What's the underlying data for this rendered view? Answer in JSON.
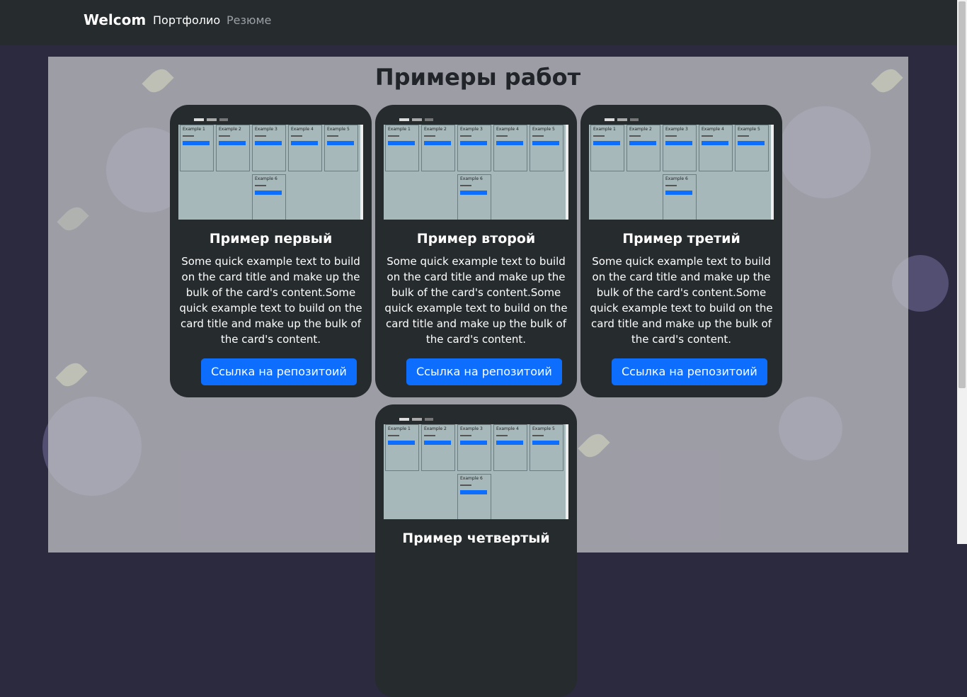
{
  "navbar": {
    "brand": "Welcom",
    "links": [
      {
        "label": "Портфолио",
        "active": true
      },
      {
        "label": "Резюме",
        "active": false
      }
    ]
  },
  "page": {
    "title": "Примеры работ"
  },
  "cards": [
    {
      "title": "Пример первый",
      "text": "Some quick example text to build on the card title and make up the bulk of the card's content.Some quick example text to build on the card title and make up the bulk of the card's content.",
      "button": "Ссылка на репозитоий"
    },
    {
      "title": "Пример второй",
      "text": "Some quick example text to build on the card title and make up the bulk of the card's content.Some quick example text to build on the card title and make up the bulk of the card's content.",
      "button": "Ссылка на репозитоий"
    },
    {
      "title": "Пример третий",
      "text": "Some quick example text to build on the card title and make up the bulk of the card's content.Some quick example text to build on the card title and make up the bulk of the card's content.",
      "button": "Ссылка на репозитоий"
    },
    {
      "title": "Пример четвертый",
      "text": "",
      "button": ""
    }
  ],
  "preview": {
    "cards": [
      "Example 1",
      "Example 2",
      "Example 3",
      "Example 4",
      "Example 5",
      "Example 6"
    ]
  },
  "colors": {
    "navbar": "#262b2e",
    "card": "#262b2e",
    "primary": "#0d6efd"
  }
}
